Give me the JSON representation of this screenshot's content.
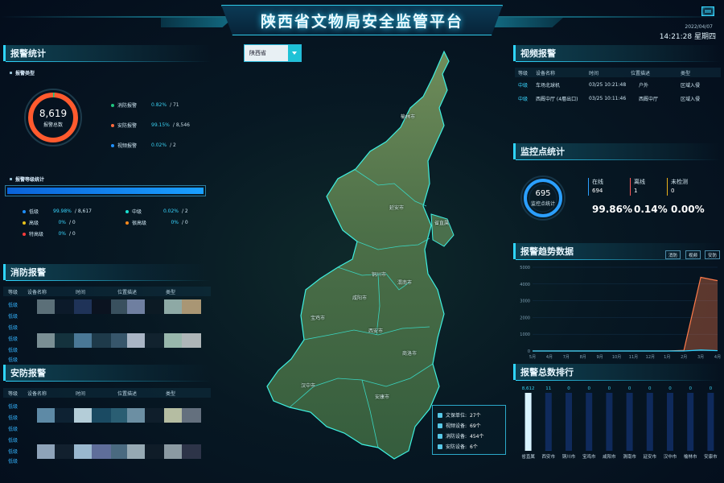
{
  "header": {
    "title": "陕西省文物局安全监管平台",
    "date": "2022/04/07",
    "time": "14:21:28 星期四"
  },
  "alarm_stats": {
    "title": "报警统计",
    "type_title": "报警类型",
    "total": "8,619",
    "total_label": "报警总数",
    "legend": [
      {
        "label": "消防报警",
        "pct": "0.82%",
        "count": "/ 71",
        "color": "#1ec47e"
      },
      {
        "label": "安防报警",
        "pct": "99.15%",
        "count": "/ 8,546",
        "color": "#ff6a3d"
      },
      {
        "label": "视频报警",
        "pct": "0.02%",
        "count": "/ 2",
        "color": "#1e90ff"
      }
    ],
    "level_title": "报警等级统计",
    "level_bar_fill": 0.9998,
    "levels": [
      {
        "label": "低级",
        "pct": "99.98%",
        "count": "/ 8,617",
        "color": "#1e90ff"
      },
      {
        "label": "中级",
        "pct": "0.02%",
        "count": "/ 2",
        "color": "#19e0d1"
      },
      {
        "label": "高级",
        "pct": "0%",
        "count": "/ 0",
        "color": "#e8c21a"
      },
      {
        "label": "很高级",
        "pct": "0%",
        "count": "/ 0",
        "color": "#ff8a1c"
      },
      {
        "label": "特高级",
        "pct": "0%",
        "count": "/ 0",
        "color": "#ff3b3b"
      }
    ]
  },
  "fire_alarm": {
    "title": "消防报警",
    "columns": [
      "等级",
      "设备名称",
      "时间",
      "位置描述",
      "类型"
    ],
    "levels": [
      "低级",
      "低级",
      "低级",
      "低级",
      "低级",
      "低级"
    ]
  },
  "security_alarm": {
    "title": "安防报警",
    "columns": [
      "等级",
      "设备名称",
      "时间",
      "位置描述",
      "类型"
    ],
    "levels": [
      "低级",
      "低级",
      "低级",
      "低级",
      "低级",
      "低级"
    ]
  },
  "province_select": {
    "value": "陕西省"
  },
  "map": {
    "cities": [
      "榆林市",
      "延安市",
      "铜川市",
      "渭南市",
      "咸阳市",
      "宝鸡市",
      "西安市",
      "商洛市",
      "汉中市",
      "安康市",
      "省直属"
    ]
  },
  "summary_box": {
    "rows": [
      {
        "label": "文保单位:",
        "value": "27个"
      },
      {
        "label": "视频设备:",
        "value": "69个"
      },
      {
        "label": "消防设备:",
        "value": "454个"
      },
      {
        "label": "安防设备:",
        "value": "6个"
      }
    ]
  },
  "video_alarm": {
    "title": "视频报警",
    "columns": [
      "等级",
      "设备名称",
      "时间",
      "位置描述",
      "类型"
    ],
    "rows": [
      {
        "level": "中级",
        "device": "车场北球机",
        "time": "03/25 10:21:48",
        "location": "户外",
        "type": "区域入侵"
      },
      {
        "level": "中级",
        "device": "西厩中厅 (4層出口)",
        "time": "03/25 10:11:46",
        "location": "西厩中厅",
        "type": "区域入侵"
      }
    ]
  },
  "monitor_stats": {
    "title": "监控点统计",
    "total": "695",
    "total_label": "监控点统计",
    "online_label": "在线",
    "online_count": "694",
    "online_pct": "99.86%",
    "offline_label": "离线",
    "offline_count": "1",
    "offline_pct": "0.14%",
    "unchecked_label": "未检测",
    "unchecked_count": "0",
    "unchecked_pct": "0.00%"
  },
  "trend": {
    "title": "报警趋势数据",
    "buttons": [
      "消防",
      "视频",
      "安防"
    ]
  },
  "ranking": {
    "title": "报警总数排行"
  },
  "chart_data": [
    {
      "type": "line",
      "x": [
        "5月",
        "4月",
        "7月",
        "8月",
        "9月",
        "10月",
        "11月",
        "12月",
        "1月",
        "2月",
        "3月",
        "4月"
      ],
      "ylim": [
        0,
        5000
      ],
      "yticks": [
        "5000",
        "4000",
        "3000",
        "2000",
        "1000",
        "0"
      ],
      "series": [
        {
          "color": "#ff7b4a",
          "values": [
            0,
            0,
            0,
            0,
            0,
            0,
            0,
            0,
            0,
            40,
            4400,
            4200
          ]
        },
        {
          "color": "#29d1ff",
          "values": [
            0,
            0,
            0,
            0,
            0,
            0,
            0,
            0,
            0,
            0,
            60,
            20
          ]
        }
      ]
    },
    {
      "type": "bar",
      "categories": [
        "省直属",
        "西安市",
        "铜川市",
        "宝鸡市",
        "咸阳市",
        "渭南市",
        "延安市",
        "汉中市",
        "榆林市",
        "安康市"
      ],
      "values": [
        8612,
        11,
        0,
        0,
        0,
        0,
        0,
        0,
        0,
        0
      ],
      "labels": [
        "8,612",
        "11",
        "0",
        "0",
        "0",
        "0",
        "0",
        "0",
        "0",
        "0"
      ]
    }
  ]
}
